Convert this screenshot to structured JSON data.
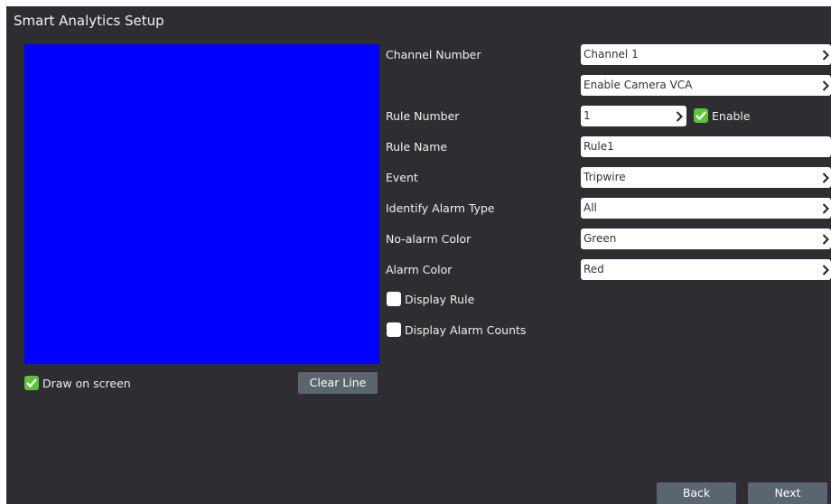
{
  "title": "Smart Analytics Setup",
  "fields": {
    "channel_number": {
      "label": "Channel Number",
      "value": "Channel 1"
    },
    "camera_vca": {
      "value": "Enable Camera VCA"
    },
    "rule_number": {
      "label": "Rule Number",
      "value": "1",
      "enable_label": "Enable",
      "enable_checked": true
    },
    "rule_name": {
      "label": "Rule Name",
      "value": "Rule1"
    },
    "event": {
      "label": "Event",
      "value": "Tripwire"
    },
    "alarm_type": {
      "label": "Identify Alarm Type",
      "value": "All"
    },
    "no_alarm_color": {
      "label": "No-alarm Color",
      "value": "Green"
    },
    "alarm_color": {
      "label": "Alarm Color",
      "value": "Red"
    }
  },
  "options": {
    "display_rule": {
      "label": "Display Rule",
      "checked": false
    },
    "display_alarm_counts": {
      "label": "Display Alarm Counts",
      "checked": false
    },
    "draw_on_screen": {
      "label": "Draw on screen",
      "checked": true
    }
  },
  "buttons": {
    "clear_line": "Clear Line",
    "back": "Back",
    "next": "Next"
  },
  "colors": {
    "preview": "#0000ff",
    "panel": "#2e2e32",
    "check_on": "#5dc33a",
    "button": "#5b6570"
  }
}
